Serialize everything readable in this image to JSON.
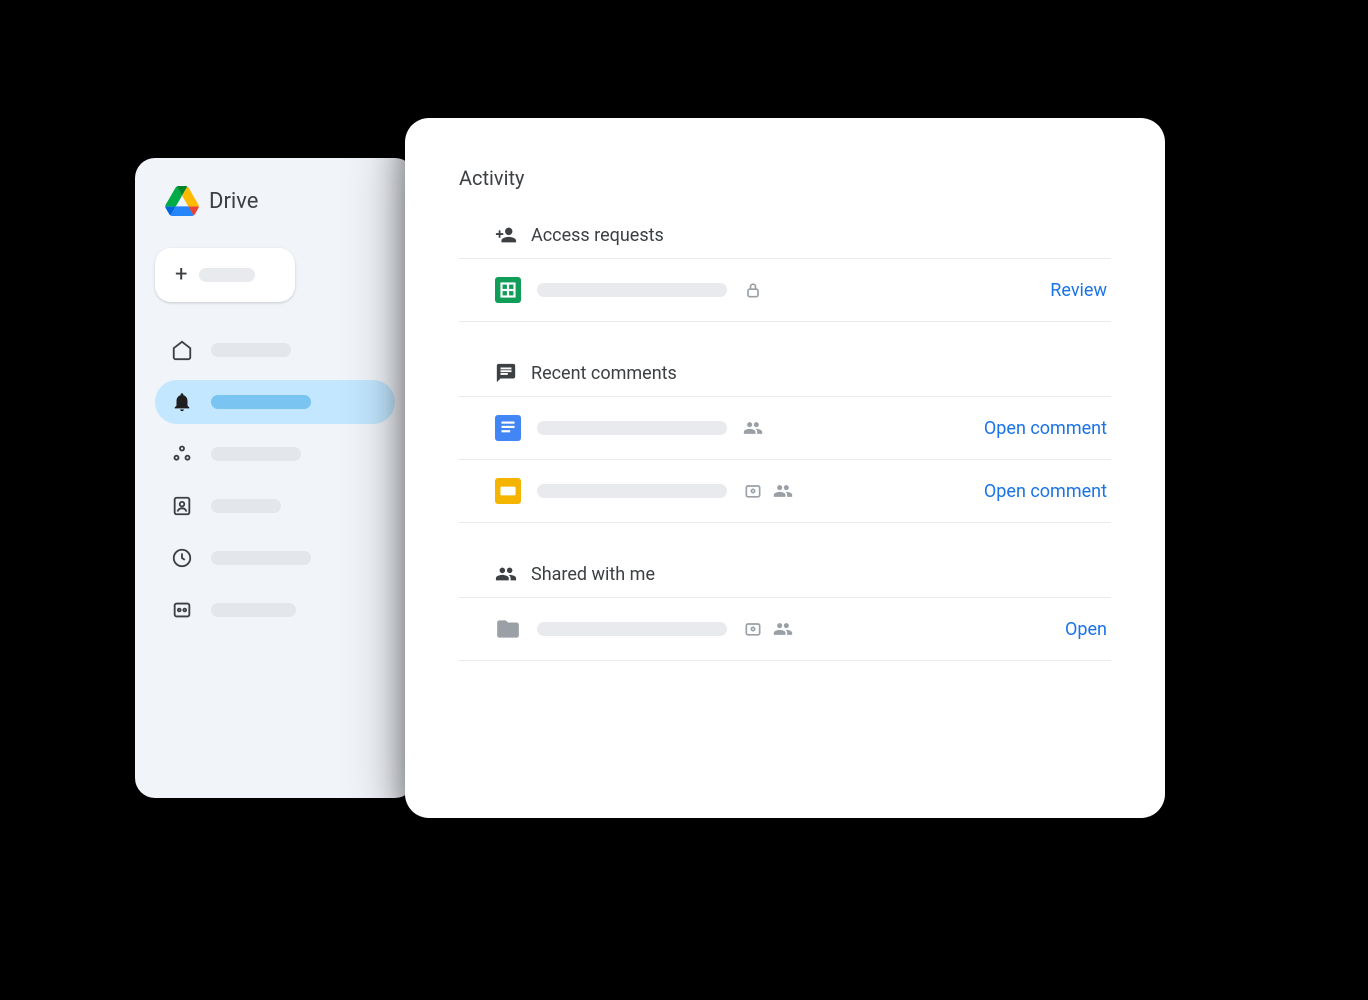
{
  "sidebar": {
    "title": "Drive"
  },
  "activity": {
    "title": "Activity",
    "sections": [
      {
        "title": "Access requests",
        "rows": [
          {
            "type": "sheets",
            "action": "Review",
            "icons": [
              "lock"
            ]
          }
        ]
      },
      {
        "title": "Recent comments",
        "rows": [
          {
            "type": "docs",
            "action": "Open comment",
            "icons": [
              "group"
            ]
          },
          {
            "type": "slides",
            "action": "Open comment",
            "icons": [
              "badge",
              "group"
            ]
          }
        ]
      },
      {
        "title": "Shared with me",
        "rows": [
          {
            "type": "folder",
            "action": "Open",
            "icons": [
              "badge",
              "group"
            ]
          }
        ]
      }
    ]
  }
}
